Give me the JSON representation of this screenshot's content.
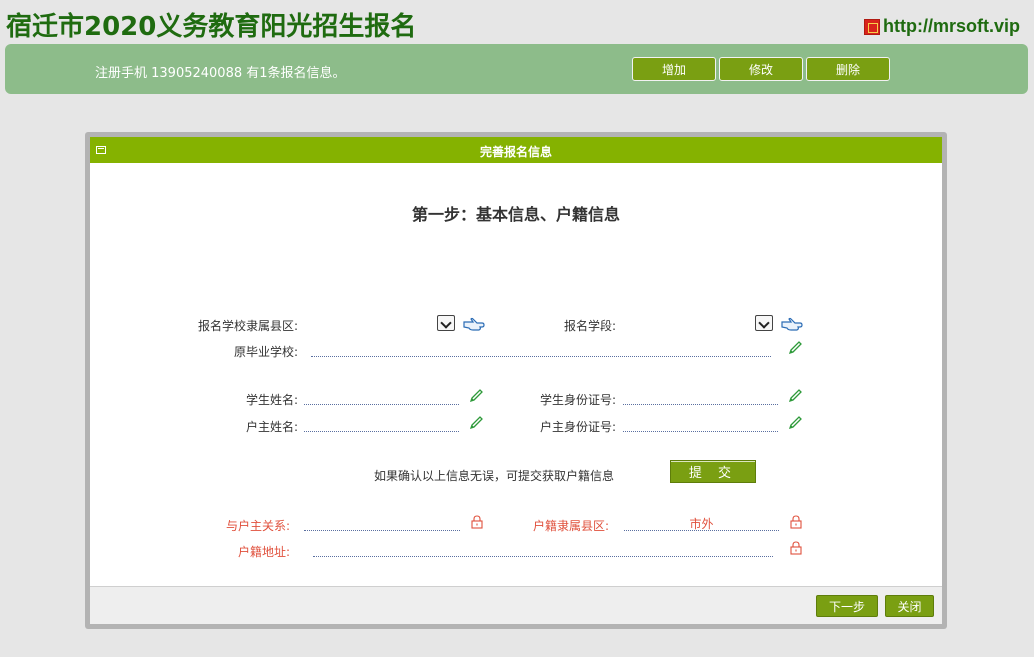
{
  "header": {
    "title": "宿迁市2020义务教育阳光招生报名",
    "url": "http://mrsoft.vip"
  },
  "info_bar": {
    "text": "注册手机 13905240088 有1条报名信息。",
    "add_label": "增加",
    "edit_label": "修改",
    "delete_label": "删除"
  },
  "dialog": {
    "title": "完善报名信息",
    "step_title": "第一步：基本信息、户籍信息",
    "fields": {
      "school_county": "报名学校隶属县区:",
      "school_stage": "报名学段:",
      "previous_school": "原毕业学校:",
      "student_name": "学生姓名:",
      "student_id": "学生身份证号:",
      "householder_name": "户主姓名:",
      "householder_id": "户主身份证号:",
      "relation": "与户主关系:",
      "household_county": "户籍隶属县区:",
      "household_county_value": "市外",
      "household_address": "户籍地址:"
    },
    "submit_note": "如果确认以上信息无误，可提交获取户籍信息",
    "submit_label": "提 交",
    "next_label": "下一步",
    "close_label": "关闭"
  },
  "colors": {
    "title_green": "#1f6b10",
    "bar_green": "#8dbc8a",
    "button_green": "#7a9f12",
    "header_green": "#85b200",
    "locked_red": "#e0503c"
  }
}
